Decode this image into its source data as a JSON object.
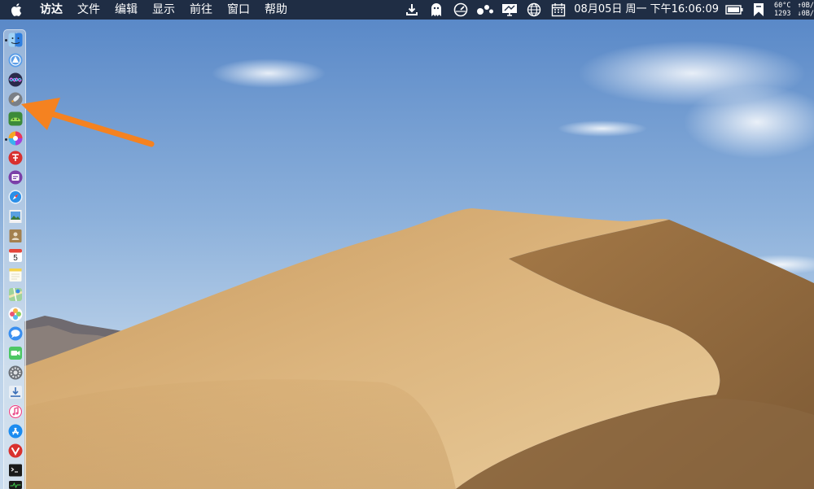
{
  "menubar": {
    "apple_icon": "apple-logo-icon",
    "items": [
      "访达",
      "文件",
      "编辑",
      "显示",
      "前往",
      "窗口",
      "帮助"
    ],
    "status_icons": [
      "download-icon",
      "ghost-icon",
      "speedometer-icon",
      "dots-icon",
      "monitor-icon",
      "globe-icon",
      "calendar-icon"
    ],
    "datetime": "08月05日 周一 下午16:06:09",
    "battery_icon": "battery-icon",
    "bookmark_icon": "bookmark-icon",
    "cpu_temp": "60°C",
    "fan_speed": "1293",
    "net_up": "↑0B/",
    "net_down": "↓0B/"
  },
  "dock": {
    "items": [
      {
        "name": "finder",
        "running": true
      },
      {
        "name": "launchpad",
        "running": false
      },
      {
        "name": "siri",
        "running": false
      },
      {
        "name": "rocket",
        "running": false
      },
      {
        "name": "android",
        "running": false
      },
      {
        "name": "color-wheel",
        "running": true
      },
      {
        "name": "red-app",
        "running": false
      },
      {
        "name": "purple-app",
        "running": false
      },
      {
        "name": "safari",
        "running": false
      },
      {
        "name": "preview",
        "running": false
      },
      {
        "name": "contacts",
        "running": false
      },
      {
        "name": "calendar",
        "running": false,
        "label": "5"
      },
      {
        "name": "notes",
        "running": false
      },
      {
        "name": "maps",
        "running": false
      },
      {
        "name": "photos",
        "running": false
      },
      {
        "name": "messages",
        "running": false
      },
      {
        "name": "facetime",
        "running": false
      },
      {
        "name": "system-preferences",
        "running": false
      },
      {
        "name": "downloads-tool",
        "running": false
      },
      {
        "name": "itunes",
        "running": false
      },
      {
        "name": "app-store",
        "running": false
      },
      {
        "name": "vivaldi",
        "running": false
      },
      {
        "name": "terminal",
        "running": false
      },
      {
        "name": "activity-monitor",
        "running": false
      }
    ]
  },
  "colors": {
    "menubar_bg": "#1f2d44",
    "arrow": "#f58220",
    "sky_top": "#5585c6",
    "sand": "#d9b27c"
  }
}
